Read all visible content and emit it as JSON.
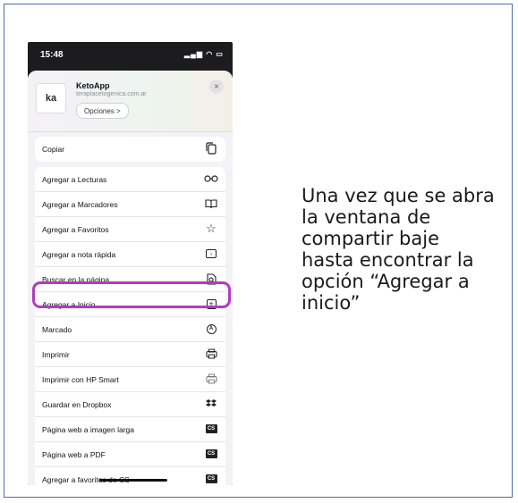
{
  "status_bar": {
    "time": "15:48",
    "indicators": "signal wifi battery"
  },
  "share_header": {
    "logo_text": "ka",
    "app_name": "KetoApp",
    "app_url": "terapiacetogenica.com.ar",
    "options_label": "Opciones >",
    "close_label": "×"
  },
  "copy_group": [
    {
      "label": "Copiar",
      "icon": "copy-icon",
      "glyph": "⎘"
    }
  ],
  "actions": [
    {
      "label": "Agregar a Lecturas",
      "icon": "glasses-icon",
      "glyph": "oo"
    },
    {
      "label": "Agregar a Marcadores",
      "icon": "book-icon",
      "glyph": "▭"
    },
    {
      "label": "Agregar a Favoritos",
      "icon": "star-icon",
      "glyph": "☆"
    },
    {
      "label": "Agregar a nota rápida",
      "icon": "quick-note-icon",
      "glyph": "ℳ"
    },
    {
      "label": "Buscar en la página",
      "icon": "find-in-page-icon",
      "glyph": "🗋"
    },
    {
      "label": "Agregar a Inicio",
      "icon": "add-to-home-icon",
      "glyph": "+"
    },
    {
      "label": "Marcado",
      "icon": "markup-icon",
      "glyph": "A"
    },
    {
      "label": "Imprimir",
      "icon": "printer-icon",
      "glyph": "⎙"
    },
    {
      "label": "Imprimir con HP Smart",
      "icon": "hp-smart-icon",
      "glyph": "⎙"
    },
    {
      "label": "Guardar en Dropbox",
      "icon": "dropbox-icon",
      "glyph": "✦"
    },
    {
      "label": "Página web a imagen larga",
      "icon": "cs-icon",
      "glyph": "CS"
    },
    {
      "label": "Página web a PDF",
      "icon": "cs-icon",
      "glyph": "CS"
    },
    {
      "label": "Agregar a favoritos de CS",
      "icon": "cs-icon",
      "glyph": "CS"
    }
  ],
  "highlight_color": "#b13bc1",
  "instruction_text": "Una vez que se abra\nla ventana de\ncompartir baje\nhasta encontrar la\nopción “Agregar a\ninicio”"
}
